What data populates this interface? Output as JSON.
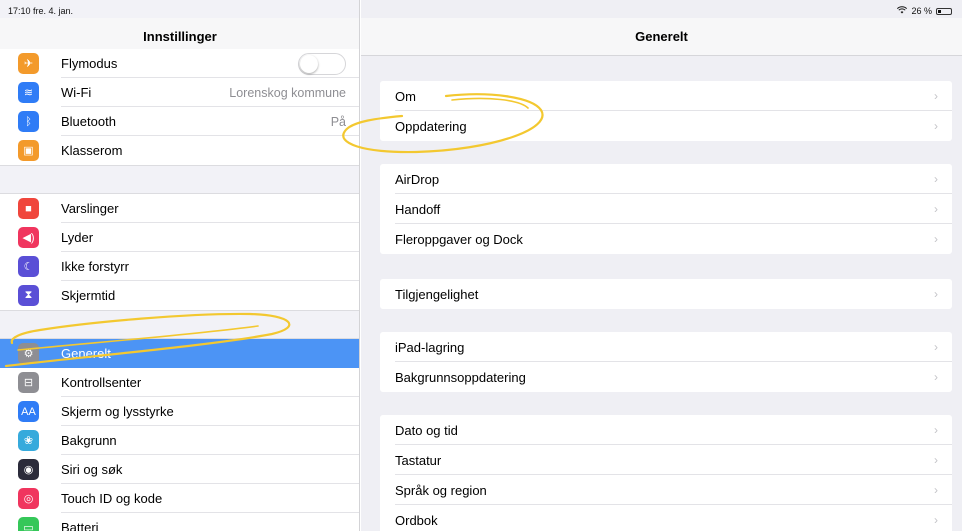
{
  "status_bar": {
    "time": "17:10  fre. 4. jan.",
    "wifi_icon": "wifi-icon",
    "battery": "26 %",
    "battery_level": 0.26
  },
  "left_panel": {
    "title": "Innstillinger",
    "group1": [
      {
        "label": "Flymodus",
        "icon": "airplane-icon",
        "color": "#f39a2b",
        "glyph": "✈",
        "toggle": false
      },
      {
        "label": "Wi-Fi",
        "icon": "wifi-icon",
        "color": "#2f7cf6",
        "glyph": "≋",
        "value": "Lorenskog kommune"
      },
      {
        "label": "Bluetooth",
        "icon": "bluetooth-icon",
        "color": "#2f7cf6",
        "glyph": "ᛒ",
        "value": "På"
      },
      {
        "label": "Klasserom",
        "icon": "classroom-icon",
        "color": "#f39a2b",
        "glyph": "▣"
      }
    ],
    "group2": [
      {
        "label": "Varslinger",
        "icon": "notifications-icon",
        "color": "#f0463c",
        "glyph": "■"
      },
      {
        "label": "Lyder",
        "icon": "sounds-icon",
        "color": "#f0355e",
        "glyph": "◀)"
      },
      {
        "label": "Ikke forstyrr",
        "icon": "moon-icon",
        "color": "#5a4fd6",
        "glyph": "☾"
      },
      {
        "label": "Skjermtid",
        "icon": "hourglass-icon",
        "color": "#5a4fd6",
        "glyph": "⧗"
      }
    ],
    "group3": [
      {
        "label": "Generelt",
        "icon": "gear-icon",
        "color": "#8e8e93",
        "glyph": "⚙",
        "selected": true
      },
      {
        "label": "Kontrollsenter",
        "icon": "control-center-icon",
        "color": "#8e8e93",
        "glyph": "⊟"
      },
      {
        "label": "Skjerm og lysstyrke",
        "icon": "display-brightness-icon",
        "color": "#2f7cf6",
        "glyph": "AA"
      },
      {
        "label": "Bakgrunn",
        "icon": "wallpaper-icon",
        "color": "#36aadc",
        "glyph": "❀"
      },
      {
        "label": "Siri og søk",
        "icon": "siri-icon",
        "color": "#2b2b3a",
        "glyph": "◉"
      },
      {
        "label": "Touch ID og kode",
        "icon": "fingerprint-icon",
        "color": "#f0355e",
        "glyph": "◎"
      },
      {
        "label": "Batteri",
        "icon": "battery-icon",
        "color": "#35c759",
        "glyph": "▭"
      }
    ]
  },
  "right_panel": {
    "title": "Generelt",
    "groups": [
      [
        "Om",
        "Oppdatering"
      ],
      [
        "AirDrop",
        "Handoff",
        "Fleroppgaver og Dock"
      ],
      [
        "Tilgjengelighet"
      ],
      [
        "iPad-lagring",
        "Bakgrunnsoppdatering"
      ],
      [
        "Dato og tid",
        "Tastatur",
        "Språk og region",
        "Ordbok"
      ]
    ],
    "chevron": "›"
  },
  "colors": {
    "selected_row": "#4c94f5",
    "annotation": "#f3c830"
  }
}
